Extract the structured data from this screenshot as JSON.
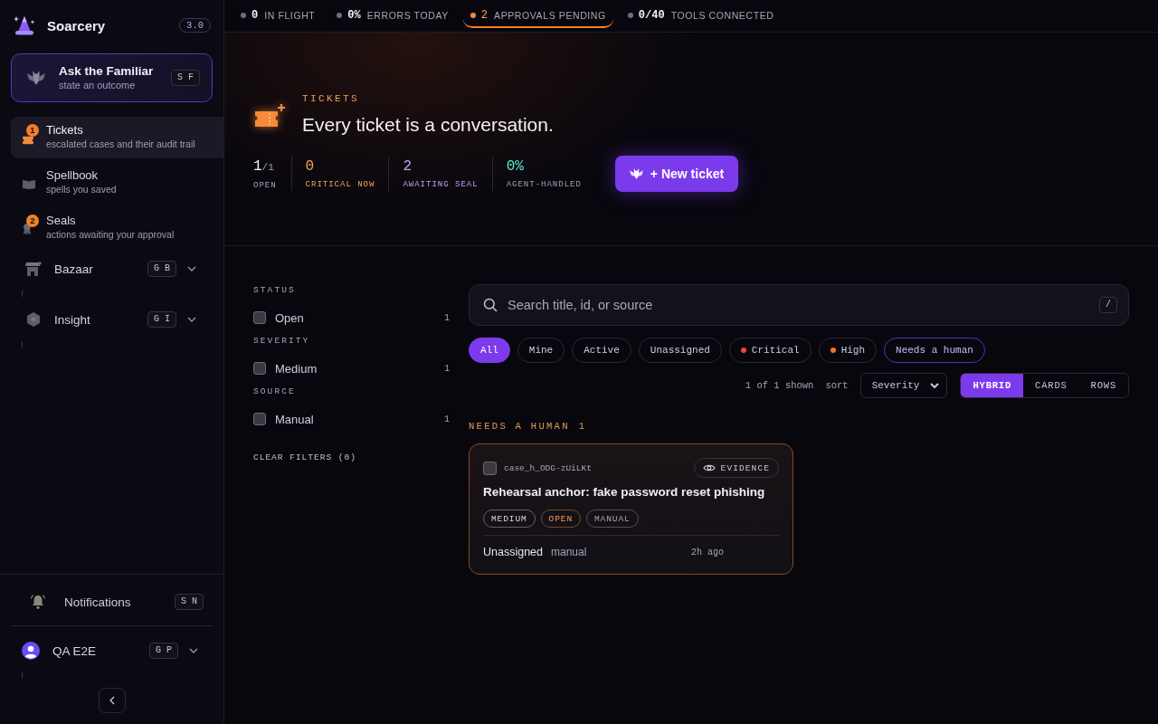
{
  "sidebar": {
    "brand": {
      "name": "Soarcery",
      "version": "3.0"
    },
    "familiar": {
      "title": "Ask the Familiar",
      "subtitle": "state an outcome",
      "shortcut": "S F"
    },
    "nav": [
      {
        "label": "Tickets",
        "description": "escalated cases and their audit trail",
        "badge": "1",
        "selected": true
      },
      {
        "label": "Spellbook",
        "description": "spells you saved",
        "selected": false
      },
      {
        "label": "Seals",
        "description": "actions awaiting your approval",
        "badge": "2",
        "selected": false
      }
    ],
    "groups": [
      {
        "label": "Bazaar",
        "shortcut": "G B",
        "expanded": false
      },
      {
        "label": "Insight",
        "shortcut": "G I",
        "expanded": false
      }
    ],
    "notifications": {
      "label": "Notifications",
      "shortcut": "S N"
    },
    "user": {
      "name": "QA E2E",
      "shortcut": "G P",
      "expanded": false
    }
  },
  "status_bar": [
    {
      "value": "0",
      "label": "IN FLIGHT",
      "color": "#64708a",
      "highlighted": false
    },
    {
      "value": "0%",
      "label": "ERRORS TODAY",
      "color": "#64708a",
      "highlighted": false
    },
    {
      "value": "2",
      "label": "APPROVALS PENDING",
      "color": "#f28a3c",
      "highlighted": true
    },
    {
      "value": "0/40",
      "label": "TOOLS CONNECTED",
      "color": "#64708a",
      "highlighted": false
    }
  ],
  "header": {
    "eyebrow": "TICKETS",
    "title": "Every ticket is a conversation.",
    "metrics": [
      {
        "value": "1",
        "total": "/1",
        "label": "OPEN",
        "color": "#f3f2f8",
        "tinted_label": false
      },
      {
        "value": "0",
        "label": "CRITICAL NOW",
        "color": "#f2a65a",
        "tinted_label": true
      },
      {
        "value": "2",
        "label": "AWAITING SEAL",
        "color": "#b9a6f7",
        "tinted_label": true
      },
      {
        "value": "0%",
        "label": "AGENT-HANDLED",
        "color": "#5eead4",
        "tinted_label": false
      }
    ],
    "new_button": "+ New ticket"
  },
  "filters": {
    "groups": [
      {
        "heading": "STATUS",
        "options": [
          {
            "label": "Open",
            "count": "1",
            "checked": false
          }
        ]
      },
      {
        "heading": "SEVERITY",
        "options": [
          {
            "label": "Medium",
            "count": "1",
            "checked": false
          }
        ]
      },
      {
        "heading": "SOURCE",
        "options": [
          {
            "label": "Manual",
            "count": "1",
            "checked": false
          }
        ]
      }
    ],
    "clear": "CLEAR FILTERS (0)"
  },
  "search": {
    "placeholder": "Search title, id, or source",
    "shortcut": "/"
  },
  "chips": [
    {
      "label": "All",
      "kind": "plain",
      "selected": true
    },
    {
      "label": "Mine",
      "kind": "plain",
      "selected": false
    },
    {
      "label": "Active",
      "kind": "plain",
      "selected": false
    },
    {
      "label": "Unassigned",
      "kind": "plain",
      "selected": false
    },
    {
      "label": "Critical",
      "kind": "severity",
      "color": "#ef4444",
      "selected": false
    },
    {
      "label": "High",
      "kind": "severity",
      "color": "#f97316",
      "selected": false
    },
    {
      "label": "Needs a human",
      "kind": "accent",
      "selected": false
    }
  ],
  "results": {
    "summary": "1 of 1 shown",
    "sort_label": "sort",
    "sort_value": "Severity",
    "views": [
      {
        "label": "HYBRID",
        "selected": true
      },
      {
        "label": "CARDS",
        "selected": false
      },
      {
        "label": "ROWS",
        "selected": false
      }
    ]
  },
  "section": {
    "title": "NEEDS A HUMAN",
    "count": "1"
  },
  "tickets": [
    {
      "id": "case_h_ODG-zUiLKt",
      "checked": false,
      "evidence": "EVIDENCE",
      "title": "Rehearsal anchor: fake password reset phishing",
      "tags": [
        {
          "label": "MEDIUM",
          "color": "#d9d7e2"
        },
        {
          "label": "OPEN",
          "color": "#f0a15a"
        },
        {
          "label": "MANUAL",
          "color": "#a9a7b5"
        }
      ],
      "assignee": "Unassigned",
      "source": "manual",
      "time": "2h ago"
    }
  ]
}
